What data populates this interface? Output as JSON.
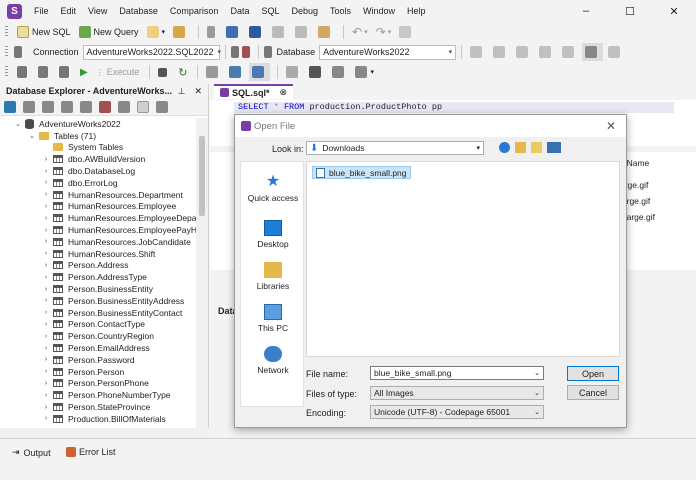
{
  "app": {
    "menus": [
      "File",
      "Edit",
      "View",
      "Database",
      "Comparison",
      "Data",
      "SQL",
      "Debug",
      "Tools",
      "Window",
      "Help"
    ],
    "window_controls": {
      "minimize": "–",
      "maximize": "☐",
      "close": "✕"
    }
  },
  "toolbar1": {
    "new_sql": "New SQL",
    "new_query": "New Query"
  },
  "toolbar2": {
    "connection_label": "Connection",
    "connection_value": "AdventureWorks2022.SQL2022",
    "database_label": "Database",
    "database_value": "AdventureWorks2022"
  },
  "toolbar3": {
    "execute": "Execute"
  },
  "db_explorer": {
    "title": "Database Explorer - AdventureWorks...",
    "pin": "⊥",
    "close": "✕",
    "root": "AdventureWorks2022",
    "tables_label": "Tables (71)",
    "system_tables": "System Tables",
    "tables": [
      "dbo.AWBuildVersion",
      "dbo.DatabaseLog",
      "dbo.ErrorLog",
      "HumanResources.Department",
      "HumanResources.Employee",
      "HumanResources.EmployeeDepartme",
      "HumanResources.EmployeePayHistor",
      "HumanResources.JobCandidate",
      "HumanResources.Shift",
      "Person.Address",
      "Person.AddressType",
      "Person.BusinessEntity",
      "Person.BusinessEntityAddress",
      "Person.BusinessEntityContact",
      "Person.ContactType",
      "Person.CountryRegion",
      "Person.EmailAddress",
      "Person.Password",
      "Person.Person",
      "Person.PersonPhone",
      "Person.PhoneNumberType",
      "Person.StateProvince",
      "Production.BillOfMaterials"
    ]
  },
  "document": {
    "tab_label": "SQL.sql*",
    "sql_select": "SELECT",
    "sql_star": "*",
    "sql_from": "FROM",
    "sql_rest": "production.ProductPhoto pp",
    "grid_header": "leName",
    "grid_values": [
      "arge.gif",
      "large.gif",
      "_large.gif"
    ],
    "data_panel_label": "Data"
  },
  "status_bar": {
    "output": "Output",
    "error_list": "Error List"
  },
  "dialog": {
    "title": "Open File",
    "close": "✕",
    "look_in_label": "Look in:",
    "look_in_value": "Downloads",
    "places": [
      "Quick access",
      "Desktop",
      "Libraries",
      "This PC",
      "Network"
    ],
    "files": [
      "blue_bike_small.png"
    ],
    "file_name_label": "File name:",
    "file_name_value": "blue_bike_small.png",
    "files_of_type_label": "Files of type:",
    "files_of_type_value": "All Images",
    "encoding_label": "Encoding:",
    "encoding_value": "Unicode (UTF-8) - Codepage 65001",
    "open_button": "Open",
    "cancel_button": "Cancel"
  }
}
